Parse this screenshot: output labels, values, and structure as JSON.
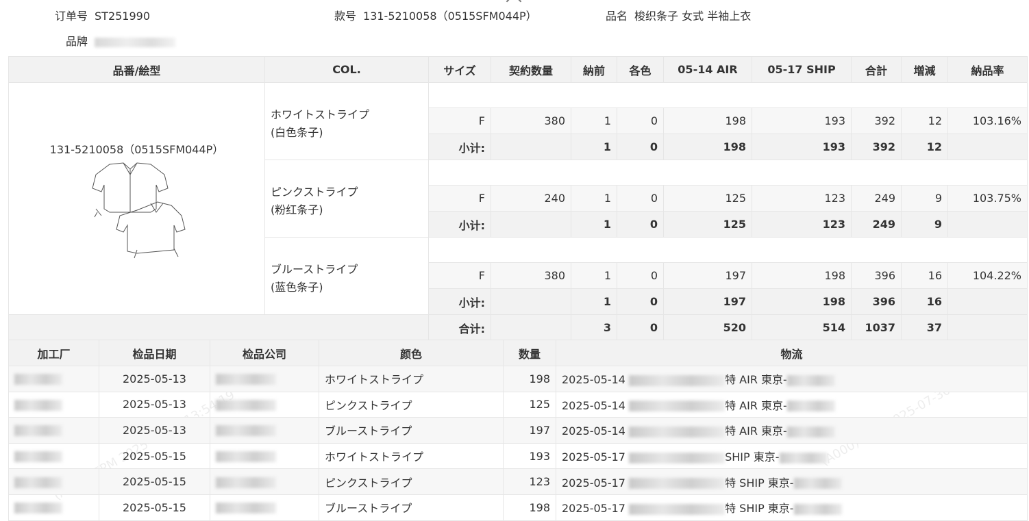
{
  "header": {
    "order_label": "订单号",
    "order_value": "ST251990",
    "style_label": "款号",
    "style_value": "131-5210058（0515SFM044P）",
    "name_label": "品名",
    "name_value": "梭织条子 女式 半袖上衣",
    "brand_label": "品牌"
  },
  "table1": {
    "columns": [
      "品番/絵型",
      "COL.",
      "サイズ",
      "契約数量",
      "納前",
      "各色",
      "05-14 AIR",
      "05-17 SHIP",
      "合計",
      "増減",
      "納品率"
    ],
    "style_no": "131-5210058（0515SFM044P）",
    "groups": [
      {
        "color_jp": "ホワイトストライプ",
        "color_cn": "(白色条子)",
        "size": "F",
        "contract": "380",
        "before": "1",
        "each": "0",
        "air": "198",
        "ship": "193",
        "total": "392",
        "diff": "12",
        "rate": "103.16%",
        "sub_label": "小计:",
        "sub_before": "1",
        "sub_each": "0",
        "sub_air": "198",
        "sub_ship": "193",
        "sub_total": "392",
        "sub_diff": "12"
      },
      {
        "color_jp": "ピンクストライプ",
        "color_cn": "(粉红条子)",
        "size": "F",
        "contract": "240",
        "before": "1",
        "each": "0",
        "air": "125",
        "ship": "123",
        "total": "249",
        "diff": "9",
        "rate": "103.75%",
        "sub_label": "小计:",
        "sub_before": "1",
        "sub_each": "0",
        "sub_air": "125",
        "sub_ship": "123",
        "sub_total": "249",
        "sub_diff": "9"
      },
      {
        "color_jp": "ブルーストライプ",
        "color_cn": "(蓝色条子)",
        "size": "F",
        "contract": "380",
        "before": "1",
        "each": "0",
        "air": "197",
        "ship": "198",
        "total": "396",
        "diff": "16",
        "rate": "104.22%",
        "sub_label": "小计:",
        "sub_before": "1",
        "sub_each": "0",
        "sub_air": "197",
        "sub_ship": "198",
        "sub_total": "396",
        "sub_diff": "16"
      }
    ],
    "grand": {
      "label": "合计:",
      "before": "3",
      "each": "0",
      "air": "520",
      "ship": "514",
      "total": "1037",
      "diff": "37"
    }
  },
  "table2": {
    "columns": [
      "加工厂",
      "检品日期",
      "检品公司",
      "颜色",
      "数量",
      "物流"
    ],
    "rows": [
      {
        "date": "2025-05-13",
        "color": "ホワイトストライプ",
        "qty": "198",
        "log_date": "2025-05-14",
        "log_mid": "特 AIR 東京-"
      },
      {
        "date": "2025-05-13",
        "color": "ピンクストライプ",
        "qty": "125",
        "log_date": "2025-05-14",
        "log_mid": "特 AIR 東京-"
      },
      {
        "date": "2025-05-13",
        "color": "ブルーストライプ",
        "qty": "197",
        "log_date": "2025-05-14",
        "log_mid": "特 AIR 東京-"
      },
      {
        "date": "2025-05-15",
        "color": "ホワイトストライプ",
        "qty": "193",
        "log_date": "2025-05-17",
        "log_mid": "SHIP 東京-"
      },
      {
        "date": "2025-05-15",
        "color": "ピンクストライプ",
        "qty": "123",
        "log_date": "2025-05-17",
        "log_mid": "特 SHIP 東京-"
      },
      {
        "date": "2025-05-15",
        "color": "ブルーストライプ",
        "qty": "198",
        "log_date": "2025-05-17",
        "log_mid": "特 SHIP 東京-"
      }
    ]
  },
  "watermark": {
    "text": "(A000) EPM  2025-07-30 13:54:19"
  }
}
